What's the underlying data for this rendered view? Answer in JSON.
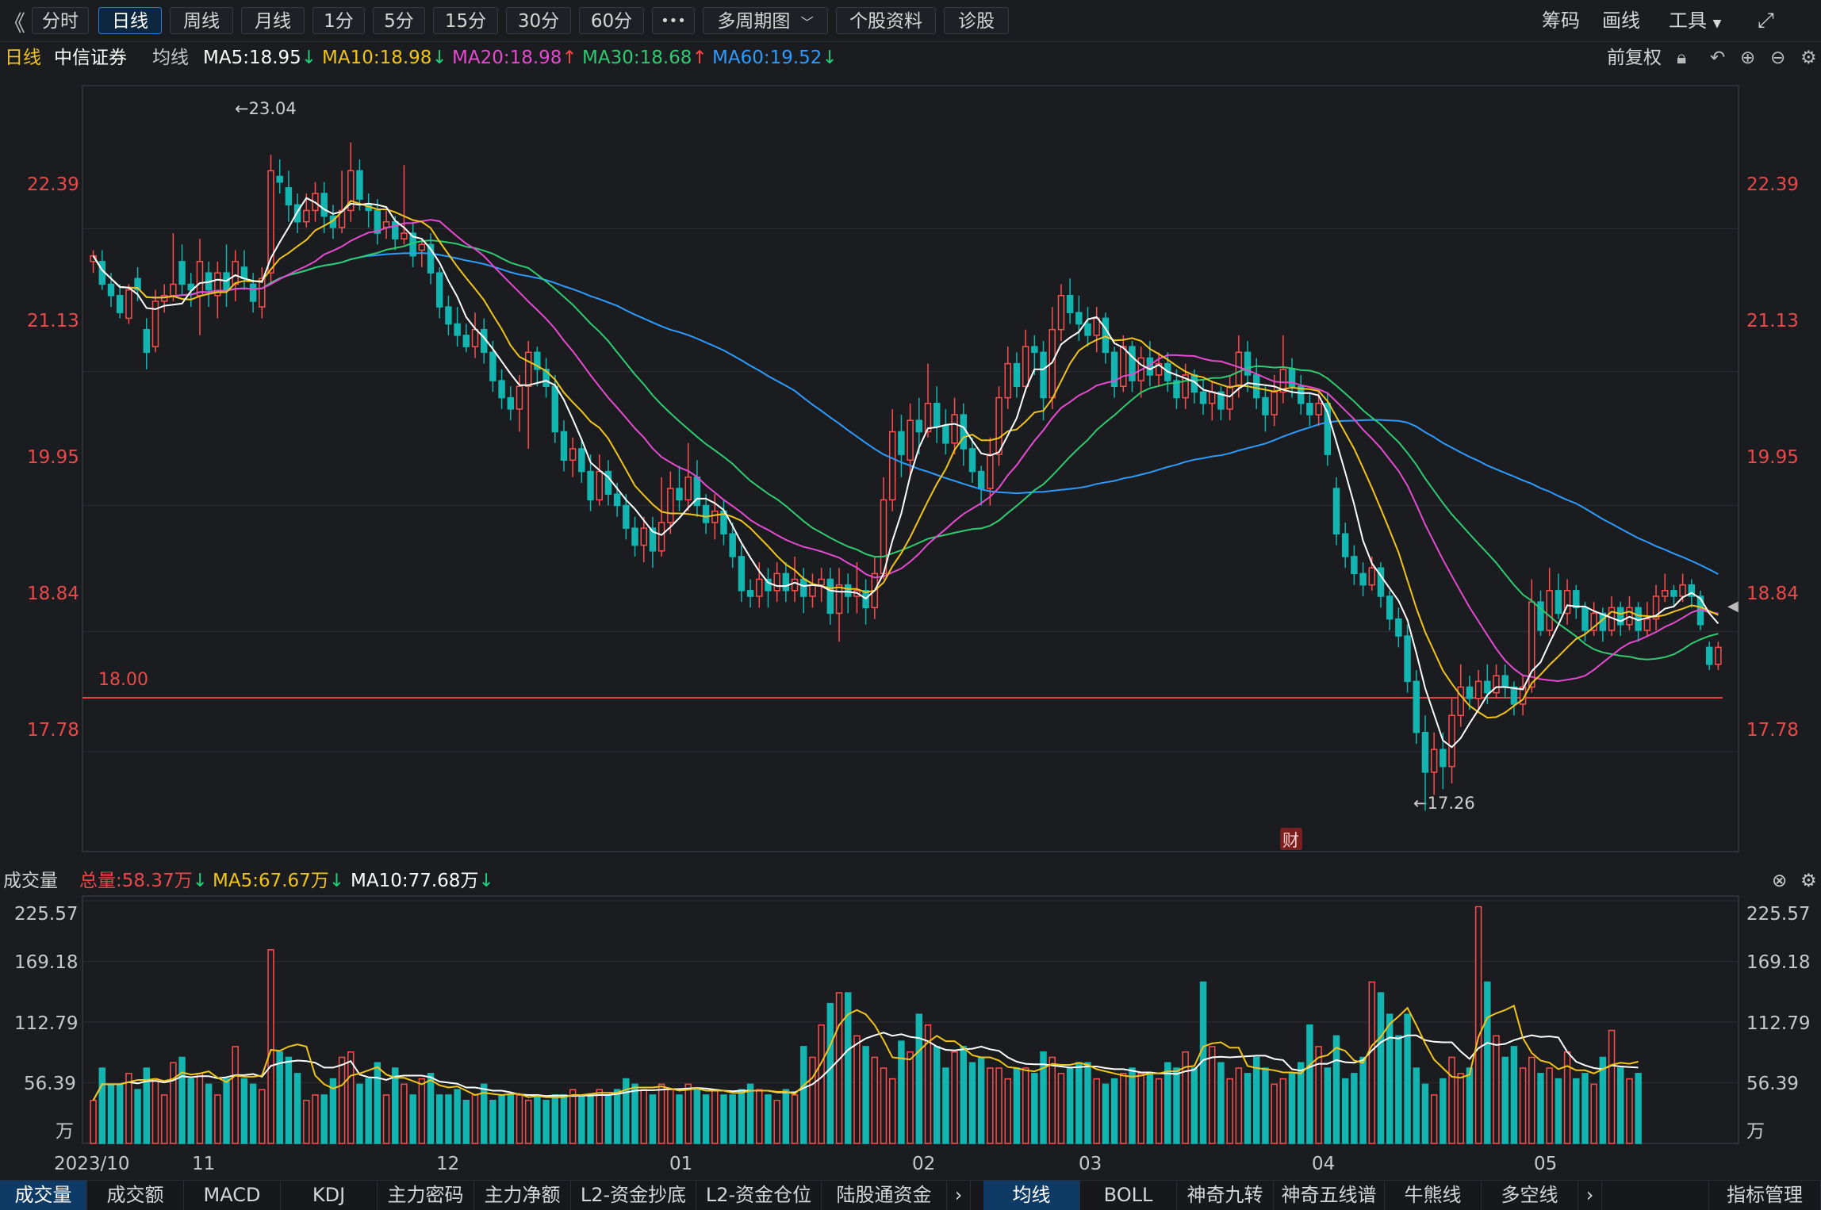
{
  "toolbar": {
    "collapse_icon": "double-chevron-left-icon",
    "periods": [
      "分时",
      "日线",
      "周线",
      "月线",
      "1分",
      "5分",
      "15分",
      "30分",
      "60分"
    ],
    "active_period": "日线",
    "more_label": "•••",
    "multi_period": "多周期图",
    "stock_info": "个股资料",
    "diagnose": "诊股",
    "chips": "筹码",
    "draw": "画线",
    "tools": "工具",
    "fullscreen_icon": "expand-icon"
  },
  "info": {
    "period": "日线",
    "stock_name": "中信证券",
    "ma_label": "均线",
    "ma5": "MA5:18.95",
    "ma10": "MA10:18.98",
    "ma20": "MA20:18.98",
    "ma30": "MA30:18.68",
    "ma60": "MA60:19.52",
    "ma5_dir": "↓",
    "ma10_dir": "↓",
    "ma20_dir": "↑",
    "ma30_dir": "↑",
    "ma60_dir": "↓",
    "adjust": "前复权",
    "colors": {
      "ma5": "#ffffff",
      "ma10": "#f0c419",
      "ma20": "#e64ad0",
      "ma30": "#2ecc71",
      "ma60": "#2d9cff"
    }
  },
  "volume_info": {
    "title": "成交量",
    "total": "总量:58.37万",
    "total_dir": "↓",
    "ma5": "MA5:67.67万",
    "ma5_dir": "↓",
    "ma10": "MA10:77.68万",
    "ma10_dir": "↓"
  },
  "price_axis": [
    "22.39",
    "21.13",
    "19.95",
    "18.84",
    "17.78"
  ],
  "volume_axis": [
    "225.57",
    "169.18",
    "112.79",
    "56.39",
    "万"
  ],
  "annotations": {
    "high": "←23.04",
    "low": "←17.26",
    "level": "18.00",
    "fin_badge": "财"
  },
  "date_axis": [
    "2023/10",
    "11",
    "12",
    "01",
    "02",
    "03",
    "04",
    "05"
  ],
  "bottom_tabs_left": [
    "成交量",
    "成交额",
    "MACD",
    "KDJ",
    "主力密码",
    "主力净额",
    "L2-资金抄底",
    "L2-资金仓位",
    "陆股通资金"
  ],
  "bottom_tabs_right": [
    "均线",
    "BOLL",
    "神奇九转",
    "神奇五线谱",
    "牛熊线",
    "多空线"
  ],
  "indicator_manage": "指标管理",
  "chart_data": {
    "type": "candlestick",
    "ylim": [
      16.9,
      23.65
    ],
    "reference_line": 18.0,
    "high_value": 23.04,
    "low_value": 17.26,
    "volume_ylim": [
      0,
      225.57
    ],
    "candles": [
      [
        22.1,
        22.15,
        22.2,
        22.0
      ],
      [
        22.1,
        21.9,
        22.2,
        21.85
      ],
      [
        21.9,
        21.8,
        22.0,
        21.7
      ],
      [
        21.8,
        21.65,
        21.9,
        21.6
      ],
      [
        21.6,
        21.85,
        21.9,
        21.55
      ],
      [
        21.95,
        21.85,
        22.05,
        21.75
      ],
      [
        21.5,
        21.3,
        21.6,
        21.15
      ],
      [
        21.35,
        21.75,
        21.85,
        21.3
      ],
      [
        21.75,
        21.8,
        21.9,
        21.65
      ],
      [
        21.8,
        21.9,
        22.35,
        21.75
      ],
      [
        22.1,
        21.9,
        22.25,
        21.8
      ],
      [
        21.9,
        21.85,
        22.0,
        21.7
      ],
      [
        21.8,
        22.1,
        22.3,
        21.45
      ],
      [
        22.0,
        21.85,
        22.1,
        21.7
      ],
      [
        21.8,
        22.0,
        22.1,
        21.6
      ],
      [
        22.0,
        21.85,
        22.25,
        21.7
      ],
      [
        21.9,
        22.1,
        22.2,
        21.75
      ],
      [
        22.05,
        21.95,
        22.2,
        21.85
      ],
      [
        21.9,
        21.75,
        22.0,
        21.65
      ],
      [
        21.7,
        21.95,
        22.05,
        21.6
      ],
      [
        22.0,
        22.9,
        23.04,
        21.9
      ],
      [
        22.85,
        22.8,
        23.0,
        22.7
      ],
      [
        22.75,
        22.6,
        22.9,
        22.45
      ],
      [
        22.6,
        22.45,
        22.7,
        22.35
      ],
      [
        22.45,
        22.55,
        22.7,
        22.4
      ],
      [
        22.55,
        22.7,
        22.8,
        22.45
      ],
      [
        22.7,
        22.5,
        22.8,
        22.35
      ],
      [
        22.5,
        22.4,
        22.6,
        22.3
      ],
      [
        22.4,
        22.55,
        22.9,
        22.35
      ],
      [
        22.55,
        22.9,
        23.15,
        22.45
      ],
      [
        22.9,
        22.65,
        23.0,
        22.55
      ],
      [
        22.6,
        22.55,
        22.7,
        22.4
      ],
      [
        22.55,
        22.35,
        22.65,
        22.25
      ],
      [
        22.4,
        22.45,
        22.55,
        22.3
      ],
      [
        22.45,
        22.3,
        22.5,
        22.2
      ],
      [
        22.3,
        22.35,
        22.95,
        22.25
      ],
      [
        22.35,
        22.15,
        22.45,
        22.05
      ],
      [
        22.2,
        22.25,
        22.3,
        22.05
      ],
      [
        22.25,
        22.0,
        22.35,
        21.9
      ],
      [
        22.0,
        21.7,
        22.05,
        21.6
      ],
      [
        21.7,
        21.55,
        21.8,
        21.45
      ],
      [
        21.55,
        21.45,
        21.7,
        21.35
      ],
      [
        21.45,
        21.35,
        21.55,
        21.3
      ],
      [
        21.35,
        21.5,
        21.65,
        21.25
      ],
      [
        21.5,
        21.3,
        21.6,
        21.2
      ],
      [
        21.3,
        21.05,
        21.4,
        20.95
      ],
      [
        21.05,
        20.9,
        21.15,
        20.8
      ],
      [
        20.9,
        20.8,
        21.0,
        20.7
      ],
      [
        20.8,
        21.0,
        21.1,
        20.6
      ],
      [
        21.0,
        21.3,
        21.4,
        20.45
      ],
      [
        21.3,
        21.15,
        21.35,
        21.0
      ],
      [
        21.15,
        21.0,
        21.25,
        20.9
      ],
      [
        21.0,
        20.6,
        21.1,
        20.5
      ],
      [
        20.6,
        20.35,
        20.7,
        20.25
      ],
      [
        20.35,
        20.45,
        20.55,
        20.2
      ],
      [
        20.45,
        20.25,
        20.55,
        20.15
      ],
      [
        20.25,
        20.0,
        20.4,
        19.9
      ],
      [
        20.0,
        20.25,
        20.4,
        19.95
      ],
      [
        20.25,
        20.05,
        20.35,
        19.95
      ],
      [
        20.05,
        19.95,
        20.15,
        19.85
      ],
      [
        19.95,
        19.75,
        20.05,
        19.65
      ],
      [
        19.75,
        19.6,
        19.85,
        19.5
      ],
      [
        19.6,
        19.75,
        19.85,
        19.45
      ],
      [
        19.75,
        19.55,
        19.85,
        19.4
      ],
      [
        19.55,
        19.8,
        20.2,
        19.5
      ],
      [
        19.8,
        20.1,
        20.25,
        19.7
      ],
      [
        20.1,
        20.0,
        20.3,
        19.9
      ],
      [
        20.0,
        20.2,
        20.5,
        19.9
      ],
      [
        20.2,
        19.95,
        20.35,
        19.85
      ],
      [
        19.95,
        19.8,
        20.05,
        19.7
      ],
      [
        19.8,
        19.9,
        20.05,
        19.65
      ],
      [
        19.9,
        19.7,
        20.0,
        19.6
      ],
      [
        19.7,
        19.5,
        19.8,
        19.4
      ],
      [
        19.5,
        19.2,
        19.6,
        19.1
      ],
      [
        19.2,
        19.15,
        19.3,
        19.05
      ],
      [
        19.15,
        19.3,
        19.45,
        19.05
      ],
      [
        19.3,
        19.2,
        19.4,
        19.05
      ],
      [
        19.2,
        19.35,
        19.45,
        19.1
      ],
      [
        19.35,
        19.2,
        19.45,
        19.1
      ],
      [
        19.2,
        19.3,
        19.5,
        19.1
      ],
      [
        19.3,
        19.15,
        19.4,
        19.0
      ],
      [
        19.15,
        19.25,
        19.35,
        19.05
      ],
      [
        19.25,
        19.3,
        19.4,
        19.1
      ],
      [
        19.3,
        19.0,
        19.4,
        18.9
      ],
      [
        19.0,
        19.25,
        19.4,
        18.75
      ],
      [
        19.25,
        19.15,
        19.35,
        19.0
      ],
      [
        19.15,
        19.2,
        19.45,
        19.0
      ],
      [
        19.2,
        19.05,
        19.3,
        18.9
      ],
      [
        19.05,
        19.35,
        19.5,
        18.95
      ],
      [
        19.35,
        20.0,
        20.2,
        19.3
      ],
      [
        20.0,
        20.6,
        20.8,
        19.9
      ],
      [
        20.6,
        20.4,
        20.75,
        20.2
      ],
      [
        20.35,
        20.7,
        20.85,
        20.2
      ],
      [
        20.7,
        20.6,
        20.9,
        20.4
      ],
      [
        20.6,
        20.85,
        21.2,
        20.55
      ],
      [
        20.85,
        20.65,
        21.0,
        20.5
      ],
      [
        20.65,
        20.5,
        20.8,
        20.4
      ],
      [
        20.5,
        20.75,
        20.9,
        20.4
      ],
      [
        20.75,
        20.45,
        20.85,
        20.3
      ],
      [
        20.45,
        20.25,
        20.55,
        20.15
      ],
      [
        20.25,
        20.1,
        20.3,
        19.95
      ],
      [
        20.1,
        20.4,
        20.55,
        19.95
      ],
      [
        20.4,
        20.9,
        21.0,
        20.3
      ],
      [
        20.9,
        21.2,
        21.35,
        20.8
      ],
      [
        21.2,
        21.0,
        21.3,
        20.9
      ],
      [
        21.0,
        21.35,
        21.5,
        20.95
      ],
      [
        21.35,
        21.3,
        21.45,
        21.1
      ],
      [
        21.3,
        20.9,
        21.4,
        20.7
      ],
      [
        20.9,
        21.5,
        21.7,
        20.8
      ],
      [
        21.5,
        21.8,
        21.9,
        21.4
      ],
      [
        21.8,
        21.65,
        21.95,
        21.55
      ],
      [
        21.65,
        21.55,
        21.8,
        21.4
      ],
      [
        21.55,
        21.45,
        21.7,
        21.35
      ],
      [
        21.45,
        21.6,
        21.7,
        21.3
      ],
      [
        21.6,
        21.3,
        21.65,
        21.2
      ],
      [
        21.3,
        21.0,
        21.35,
        20.9
      ],
      [
        21.0,
        21.35,
        21.45,
        20.95
      ],
      [
        21.35,
        21.05,
        21.4,
        20.95
      ],
      [
        21.05,
        21.25,
        21.35,
        20.9
      ],
      [
        21.25,
        21.1,
        21.4,
        21.0
      ],
      [
        21.1,
        21.2,
        21.3,
        21.0
      ],
      [
        21.2,
        21.05,
        21.3,
        20.95
      ],
      [
        21.05,
        20.9,
        21.15,
        20.8
      ],
      [
        20.9,
        21.1,
        21.2,
        20.8
      ],
      [
        21.1,
        20.95,
        21.15,
        20.85
      ],
      [
        20.95,
        20.85,
        21.05,
        20.75
      ],
      [
        20.85,
        20.95,
        21.05,
        20.7
      ],
      [
        20.95,
        20.8,
        21.0,
        20.7
      ],
      [
        20.8,
        21.0,
        21.1,
        20.7
      ],
      [
        21.0,
        21.3,
        21.45,
        20.9
      ],
      [
        21.3,
        21.1,
        21.4,
        20.95
      ],
      [
        21.1,
        20.9,
        21.25,
        20.8
      ],
      [
        20.9,
        20.75,
        21.0,
        20.6
      ],
      [
        20.75,
        20.95,
        21.1,
        20.65
      ],
      [
        20.95,
        21.15,
        21.45,
        20.85
      ],
      [
        21.15,
        21.0,
        21.25,
        20.9
      ],
      [
        21.0,
        20.85,
        21.1,
        20.75
      ],
      [
        20.85,
        20.75,
        20.95,
        20.65
      ],
      [
        20.75,
        20.85,
        20.95,
        20.65
      ],
      [
        20.85,
        20.4,
        20.95,
        20.3
      ],
      [
        20.1,
        19.7,
        20.2,
        19.6
      ],
      [
        19.7,
        19.5,
        19.8,
        19.4
      ],
      [
        19.5,
        19.35,
        19.6,
        19.25
      ],
      [
        19.35,
        19.25,
        19.45,
        19.15
      ],
      [
        19.25,
        19.4,
        19.5,
        19.2
      ],
      [
        19.4,
        19.15,
        19.45,
        19.05
      ],
      [
        19.15,
        18.95,
        19.2,
        18.85
      ],
      [
        18.95,
        18.8,
        19.05,
        18.7
      ],
      [
        18.8,
        18.4,
        18.9,
        18.3
      ],
      [
        18.4,
        17.95,
        18.5,
        17.85
      ],
      [
        17.95,
        17.6,
        18.1,
        17.26
      ],
      [
        17.6,
        17.8,
        17.95,
        17.4
      ],
      [
        17.8,
        17.65,
        17.95,
        17.45
      ],
      [
        17.65,
        18.1,
        18.25,
        17.5
      ],
      [
        18.1,
        18.35,
        18.55,
        18.0
      ],
      [
        18.35,
        18.25,
        18.45,
        18.15
      ],
      [
        18.25,
        18.4,
        18.5,
        18.15
      ],
      [
        18.4,
        18.3,
        18.55,
        18.2
      ],
      [
        18.3,
        18.45,
        18.55,
        18.25
      ],
      [
        18.45,
        18.35,
        18.55,
        18.25
      ],
      [
        18.35,
        18.2,
        18.4,
        18.1
      ],
      [
        18.2,
        18.35,
        18.45,
        18.1
      ],
      [
        18.35,
        19.1,
        19.3,
        18.3
      ],
      [
        19.1,
        18.85,
        19.2,
        18.8
      ],
      [
        18.85,
        19.2,
        19.4,
        18.8
      ],
      [
        19.2,
        19.0,
        19.35,
        18.95
      ],
      [
        19.0,
        19.2,
        19.3,
        18.9
      ],
      [
        19.2,
        19.05,
        19.25,
        18.95
      ],
      [
        19.05,
        18.85,
        19.1,
        18.75
      ],
      [
        18.85,
        19.0,
        19.1,
        18.8
      ],
      [
        19.0,
        18.85,
        19.05,
        18.75
      ],
      [
        18.85,
        19.05,
        19.15,
        18.8
      ],
      [
        19.05,
        18.9,
        19.1,
        18.8
      ],
      [
        18.9,
        19.05,
        19.15,
        18.85
      ],
      [
        19.05,
        18.85,
        19.1,
        18.75
      ],
      [
        18.85,
        18.95,
        19.1,
        18.8
      ],
      [
        18.95,
        19.15,
        19.25,
        18.85
      ],
      [
        19.15,
        19.2,
        19.35,
        19.1
      ],
      [
        19.2,
        19.15,
        19.25,
        19.05
      ],
      [
        19.15,
        19.25,
        19.35,
        19.1
      ],
      [
        19.25,
        19.15,
        19.3,
        19.05
      ],
      [
        19.15,
        18.9,
        19.2,
        18.85
      ],
      [
        18.7,
        18.55,
        18.75,
        18.5
      ],
      [
        18.55,
        18.7,
        18.75,
        18.5
      ]
    ],
    "volumes": [
      40,
      70,
      55,
      55,
      65,
      50,
      70,
      60,
      45,
      75,
      80,
      60,
      65,
      55,
      45,
      60,
      90,
      60,
      55,
      50,
      180,
      85,
      80,
      65,
      40,
      45,
      45,
      60,
      80,
      85,
      55,
      60,
      75,
      45,
      70,
      55,
      45,
      60,
      65,
      45,
      45,
      50,
      40,
      45,
      55,
      40,
      45,
      45,
      45,
      40,
      45,
      40,
      45,
      45,
      50,
      45,
      45,
      50,
      45,
      50,
      60,
      55,
      50,
      45,
      55,
      50,
      45,
      55,
      50,
      45,
      50,
      45,
      45,
      50,
      55,
      50,
      45,
      40,
      50,
      45,
      90,
      80,
      110,
      130,
      140,
      140,
      100,
      90,
      80,
      70,
      60,
      95,
      85,
      120,
      110,
      90,
      70,
      85,
      90,
      75,
      80,
      70,
      70,
      60,
      70,
      70,
      65,
      85,
      80,
      65,
      70,
      75,
      75,
      60,
      55,
      60,
      65,
      70,
      65,
      65,
      60,
      75,
      70,
      85,
      70,
      150,
      90,
      75,
      60,
      70,
      65,
      80,
      70,
      55,
      60,
      65,
      75,
      110,
      90,
      70,
      100,
      60,
      65,
      80,
      150,
      140,
      120,
      100,
      120,
      70,
      55,
      45,
      60,
      80,
      65,
      70,
      220,
      150,
      100,
      80,
      90,
      70,
      80,
      65,
      70,
      60,
      85,
      60,
      65,
      55,
      80,
      105,
      70,
      60,
      65
    ],
    "dates": [
      "2023/10",
      "11",
      "12",
      "01",
      "02",
      "03",
      "04",
      "05"
    ]
  }
}
